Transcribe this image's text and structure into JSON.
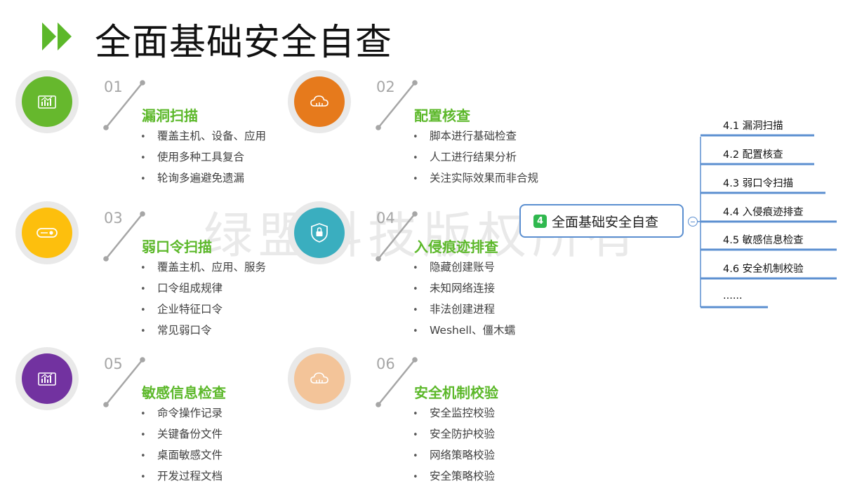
{
  "title": "全面基础安全自查",
  "watermark": "绿盟科技版权所有",
  "items": [
    {
      "num": "01",
      "heading": "漏洞扫描",
      "color": "#66b82d",
      "icon": "chart-icon",
      "bullets": [
        "覆盖主机、设备、应用",
        "使用多种工具复合",
        "轮询多遍避免遗漏"
      ]
    },
    {
      "num": "02",
      "heading": "配置核查",
      "color": "#e67a1c",
      "icon": "cloud-icon",
      "bullets": [
        "脚本进行基础检查",
        "人工进行结果分析",
        "关注实际效果而非合规"
      ]
    },
    {
      "num": "03",
      "heading": "弱口令扫描",
      "color": "#fdbf0d",
      "icon": "key-icon",
      "bullets": [
        "覆盖主机、应用、服务",
        "口令组成规律",
        "企业特征口令",
        "常见弱口令"
      ]
    },
    {
      "num": "04",
      "heading": "入侵痕迹排查",
      "color": "#3aaebf",
      "icon": "shield-lock-icon",
      "bullets": [
        "隐藏创建账号",
        "未知网络连接",
        "非法创建进程",
        "Weshell、僵木蠕"
      ]
    },
    {
      "num": "05",
      "heading": "敏感信息检查",
      "color": "#7232a0",
      "icon": "chart-icon",
      "bullets": [
        "命令操作记录",
        "关键备份文件",
        "桌面敏感文件",
        "开发过程文档"
      ]
    },
    {
      "num": "06",
      "heading": "安全机制校验",
      "color": "#f3c499",
      "icon": "cloud-icon",
      "bullets": [
        "安全监控校验",
        "安全防护校验",
        "网络策略校验",
        "安全策略校验"
      ]
    }
  ],
  "mindmap": {
    "badge": "4",
    "root": "全面基础安全自查",
    "children": [
      "4.1 漏洞扫描",
      "4.2 配置核查",
      "4.3 弱口令扫描",
      "4.4 入侵痕迹排查",
      "4.5 敏感信息检查",
      "4.6 安全机制校验",
      "......"
    ],
    "line_color": "#5b8fd0"
  }
}
